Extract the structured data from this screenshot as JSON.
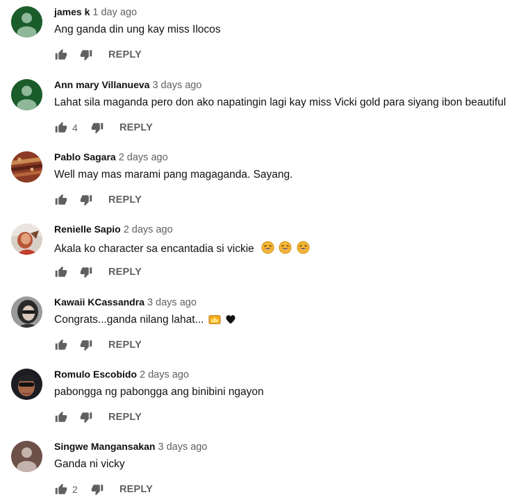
{
  "reply_label": "REPLY",
  "colors": {
    "icon": "#606060",
    "author": "#0f0f0f",
    "meta": "#606060"
  },
  "comments": [
    {
      "author": "james k",
      "time": "1 day ago",
      "text": "Ang ganda din ung kay miss Ilocos",
      "likes": "",
      "avatar": "default-green"
    },
    {
      "author": "Ann mary Villanueva",
      "time": "3 days ago",
      "text": "Lahat sila maganda pero don ako napatingin lagi kay  miss Vicki gold para siyang ibon beautiful",
      "likes": "4",
      "avatar": "default-green"
    },
    {
      "author": "Pablo Sagara",
      "time": "2 days ago",
      "text": "Well may mas marami pang magaganda. Sayang.",
      "likes": "",
      "avatar": "photo"
    },
    {
      "author": "Renielle Sapio",
      "time": "2 days ago",
      "text": "Akala ko character sa encantadia si vickie",
      "likes": "",
      "avatar": "photo",
      "emoji": [
        "laughing-face-emoji",
        "laughing-face-emoji",
        "laughing-face-emoji"
      ]
    },
    {
      "author": "Kawaii KCassandra",
      "time": "3 days ago",
      "text": "Congrats...ganda nilang lahat...",
      "likes": "",
      "avatar": "photo",
      "emoji": [
        "crown-emoji",
        "black-heart-emoji"
      ]
    },
    {
      "author": "Romulo Escobido",
      "time": "2 days ago",
      "text": "pabongga ng pabongga ang binibini ngayon",
      "likes": "",
      "avatar": "photo"
    },
    {
      "author": "Singwe Mangansakan",
      "time": "3 days ago",
      "text": "Ganda ni vicky",
      "likes": "2",
      "avatar": "default-brown"
    }
  ]
}
